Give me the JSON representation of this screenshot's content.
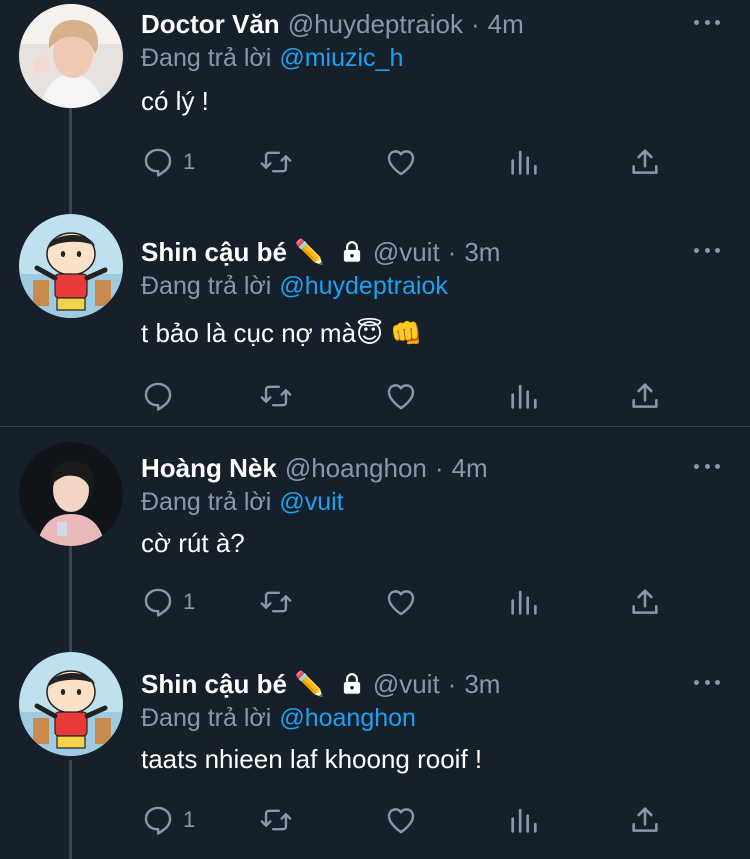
{
  "replying_label": "Đang trả lời",
  "dot": "·",
  "tweets": [
    {
      "name": "Doctor Văn",
      "name_emoji": "",
      "protected": false,
      "handle": "@huydeptraiok",
      "time": "4m",
      "reply_to": "@miuzic_h",
      "text": "có lý !",
      "reply_count": "1",
      "avatar_icon": "profile-photo"
    },
    {
      "name": "Shin cậu bé",
      "name_emoji": "✏️",
      "protected": true,
      "handle": "@vuit",
      "time": "3m",
      "reply_to": "@huydeptraiok",
      "text": "t bảo là cục nợ mà😇 👊",
      "reply_count": "",
      "avatar_icon": "cartoon-avatar"
    },
    {
      "name": "Hoàng Nèk",
      "name_emoji": "",
      "protected": false,
      "handle": "@hoanghon",
      "time": "4m",
      "reply_to": "@vuit",
      "text": "cờ rút à?",
      "reply_count": "1",
      "avatar_icon": "profile-photo"
    },
    {
      "name": "Shin cậu bé",
      "name_emoji": "✏️",
      "protected": true,
      "handle": "@vuit",
      "time": "3m",
      "reply_to": "@hoanghon",
      "text": "taats nhieen laf khoong rooif !",
      "reply_count": "1",
      "avatar_icon": "cartoon-avatar"
    }
  ],
  "colors": {
    "background": "#15202b",
    "secondary_text": "#8899a6",
    "mention": "#1da1f2",
    "border": "#38444d"
  },
  "icons": [
    "reply-icon",
    "retweet-icon",
    "like-icon",
    "analytics-icon",
    "share-icon",
    "more-icon",
    "lock-icon"
  ]
}
